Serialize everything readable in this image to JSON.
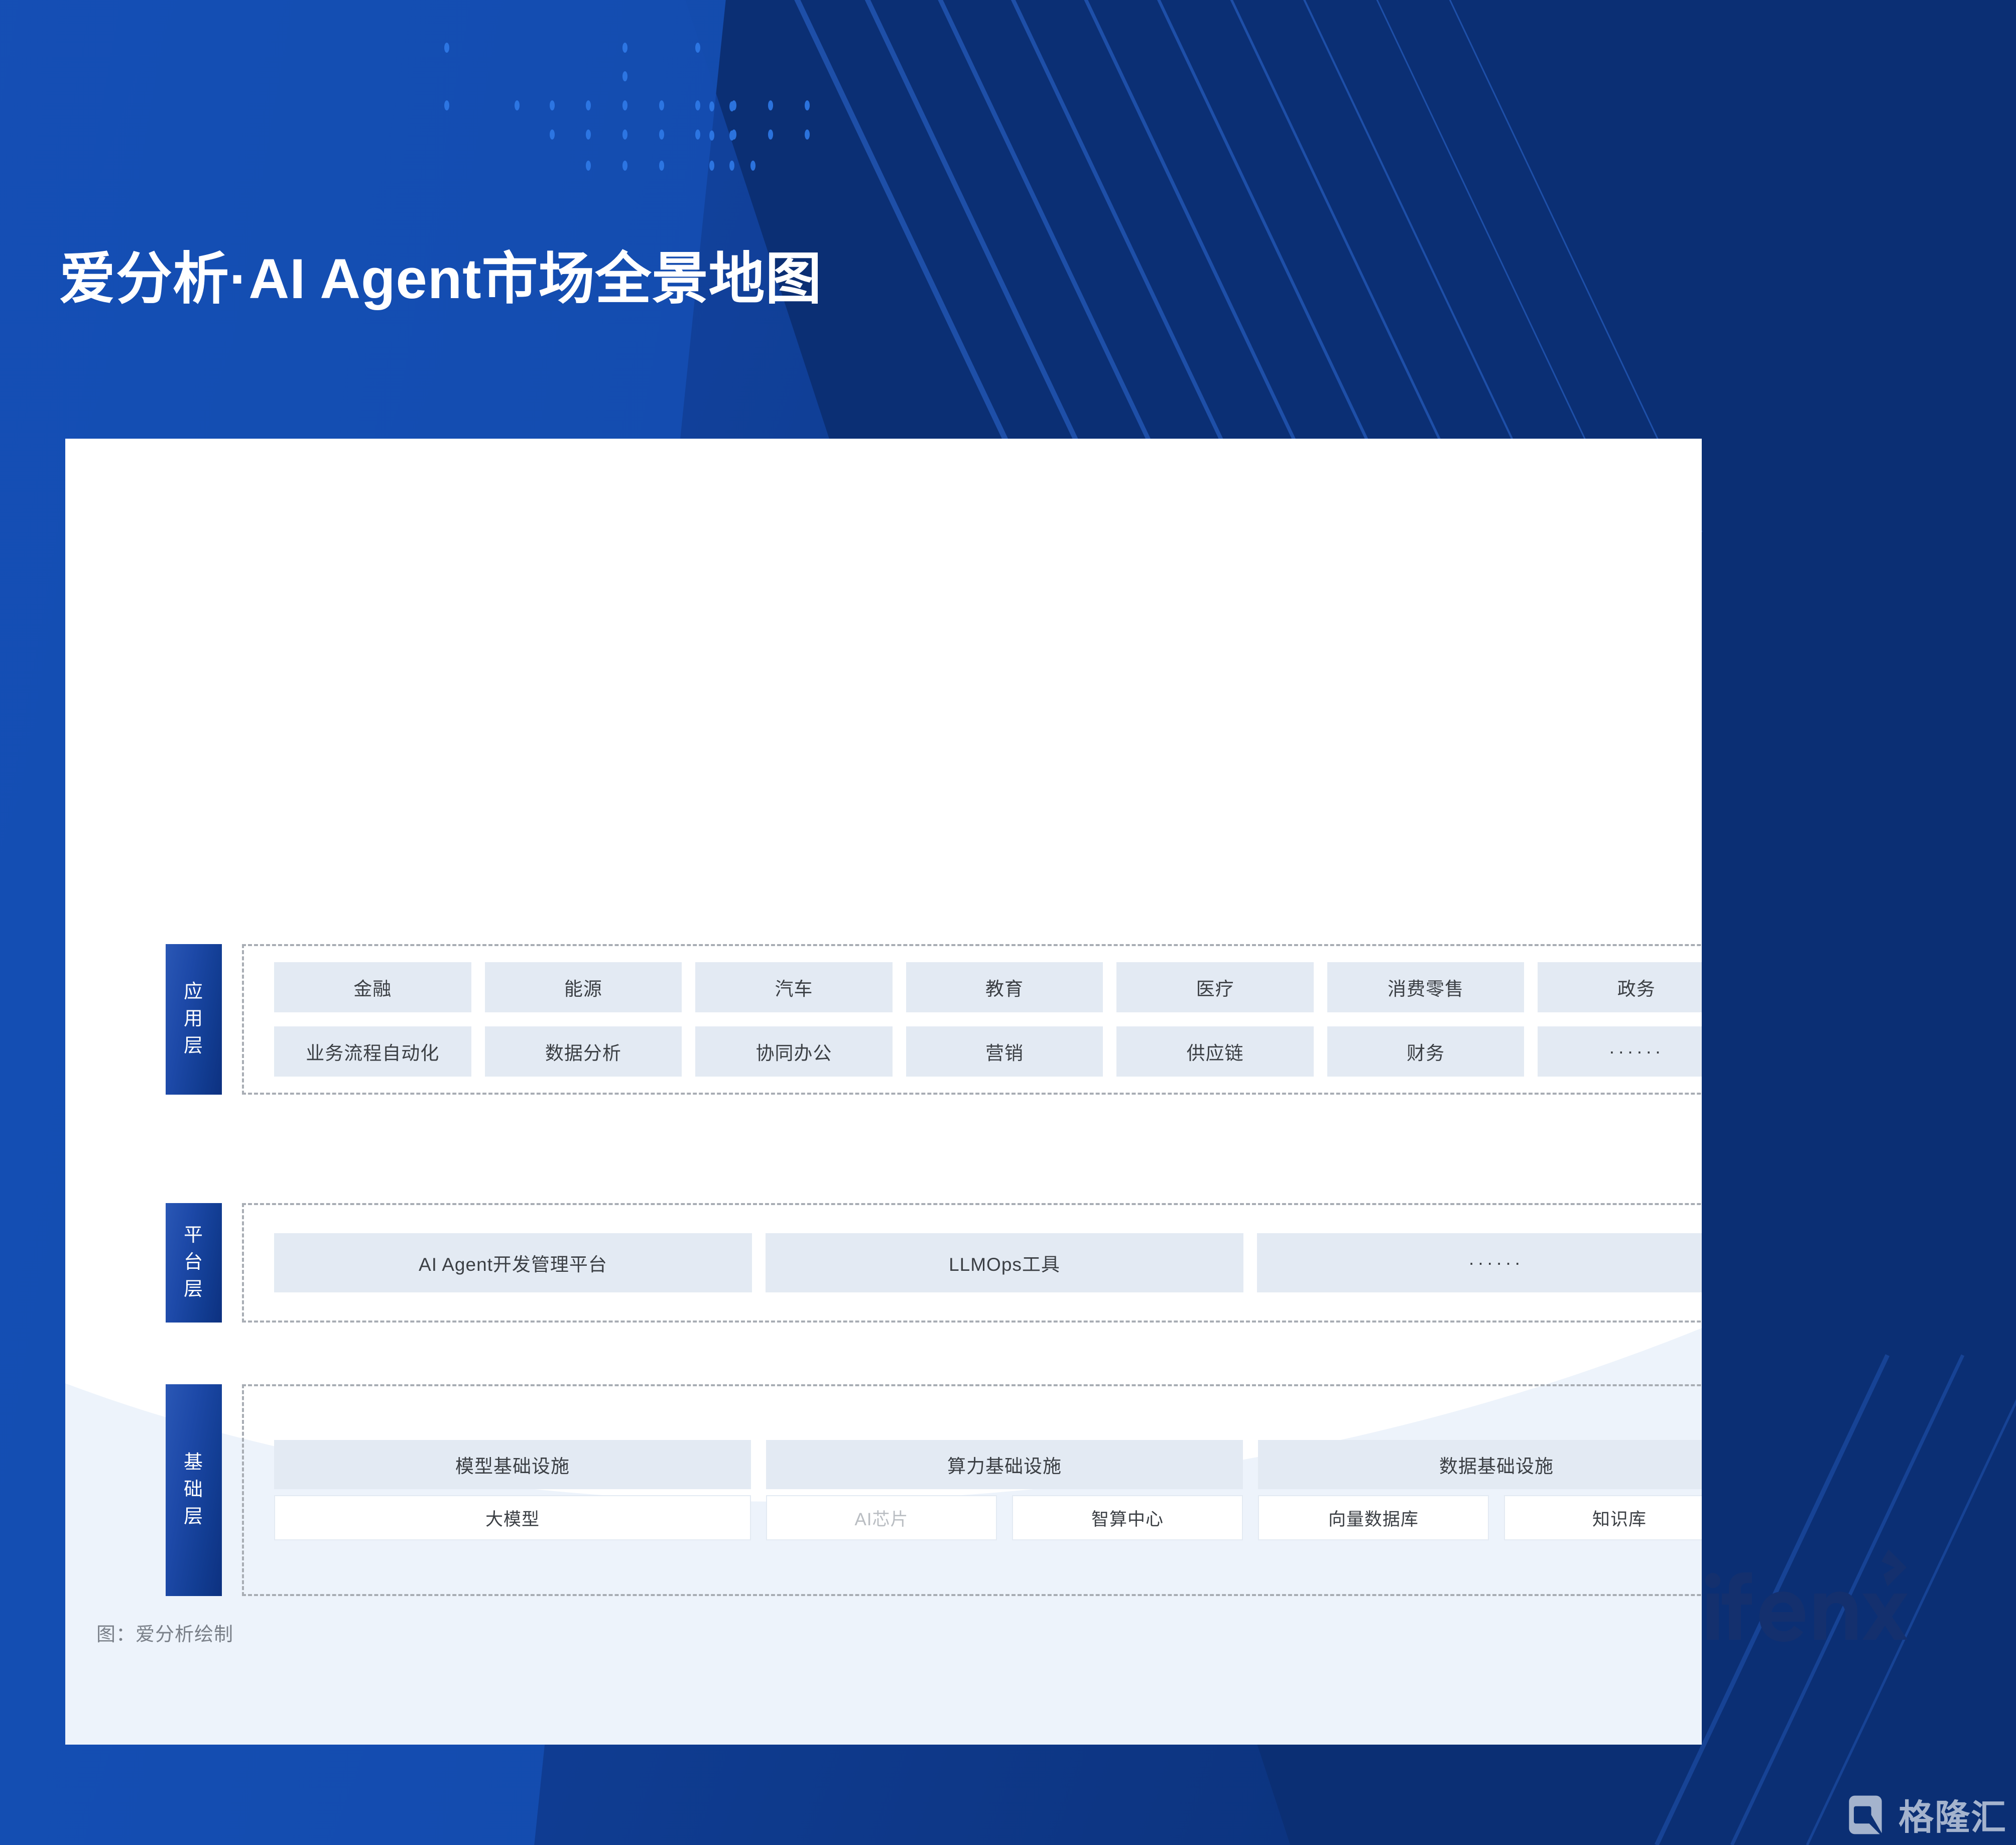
{
  "page": {
    "title": "爱分析·AI Agent市场全景地图",
    "source_note": "图：爱分析绘制",
    "brand_logo_text": "ifenxi",
    "watermark_text": "格隆汇"
  },
  "colors": {
    "background_blue": "#0d3f96",
    "background_blue_dark": "#0b2f74",
    "card_white": "#ffffff",
    "card_wave": "#edf3fb",
    "tile_fill": "#e3eaf3",
    "tile_text": "#3b3f44",
    "tile_text_muted": "#b9bdc2",
    "layer_tab_blue": "#1d49a8",
    "dashed_border": "#a8adb4",
    "note_gray": "#7a8089",
    "brand_navy": "#14306e"
  },
  "layers": [
    {
      "id": "application",
      "tab_label": "应用层",
      "tab_chars": [
        "应",
        "用",
        "层"
      ],
      "rows": [
        {
          "id": "app-industries",
          "tiles": [
            {
              "label": "金融",
              "muted": false
            },
            {
              "label": "能源",
              "muted": false
            },
            {
              "label": "汽车",
              "muted": false
            },
            {
              "label": "教育",
              "muted": false
            },
            {
              "label": "医疗",
              "muted": false
            },
            {
              "label": "消费零售",
              "muted": false
            },
            {
              "label": "政务",
              "muted": false
            }
          ]
        },
        {
          "id": "app-scenarios",
          "tiles": [
            {
              "label": "业务流程自动化",
              "muted": false
            },
            {
              "label": "数据分析",
              "muted": false
            },
            {
              "label": "协同办公",
              "muted": false
            },
            {
              "label": "营销",
              "muted": false
            },
            {
              "label": "供应链",
              "muted": false
            },
            {
              "label": "财务",
              "muted": false
            },
            {
              "label": "······",
              "muted": false
            }
          ]
        }
      ]
    },
    {
      "id": "platform",
      "tab_label": "平台层",
      "tab_chars": [
        "平",
        "台",
        "层"
      ],
      "rows": [
        {
          "id": "platform-tools",
          "tiles": [
            {
              "label": "AI Agent开发管理平台",
              "muted": false
            },
            {
              "label": "LLMOps工具",
              "muted": false
            },
            {
              "label": "······",
              "muted": false
            }
          ]
        }
      ]
    },
    {
      "id": "infrastructure",
      "tab_label": "基础层",
      "tab_chars": [
        "基",
        "础",
        "层"
      ],
      "groups": [
        {
          "head": "模型基础设施",
          "subs": [
            {
              "label": "大模型",
              "muted": false
            }
          ]
        },
        {
          "head": "算力基础设施",
          "subs": [
            {
              "label": "AI芯片",
              "muted": true
            },
            {
              "label": "智算中心",
              "muted": false
            }
          ]
        },
        {
          "head": "数据基础设施",
          "subs": [
            {
              "label": "向量数据库",
              "muted": false
            },
            {
              "label": "知识库",
              "muted": false
            }
          ]
        }
      ]
    }
  ]
}
